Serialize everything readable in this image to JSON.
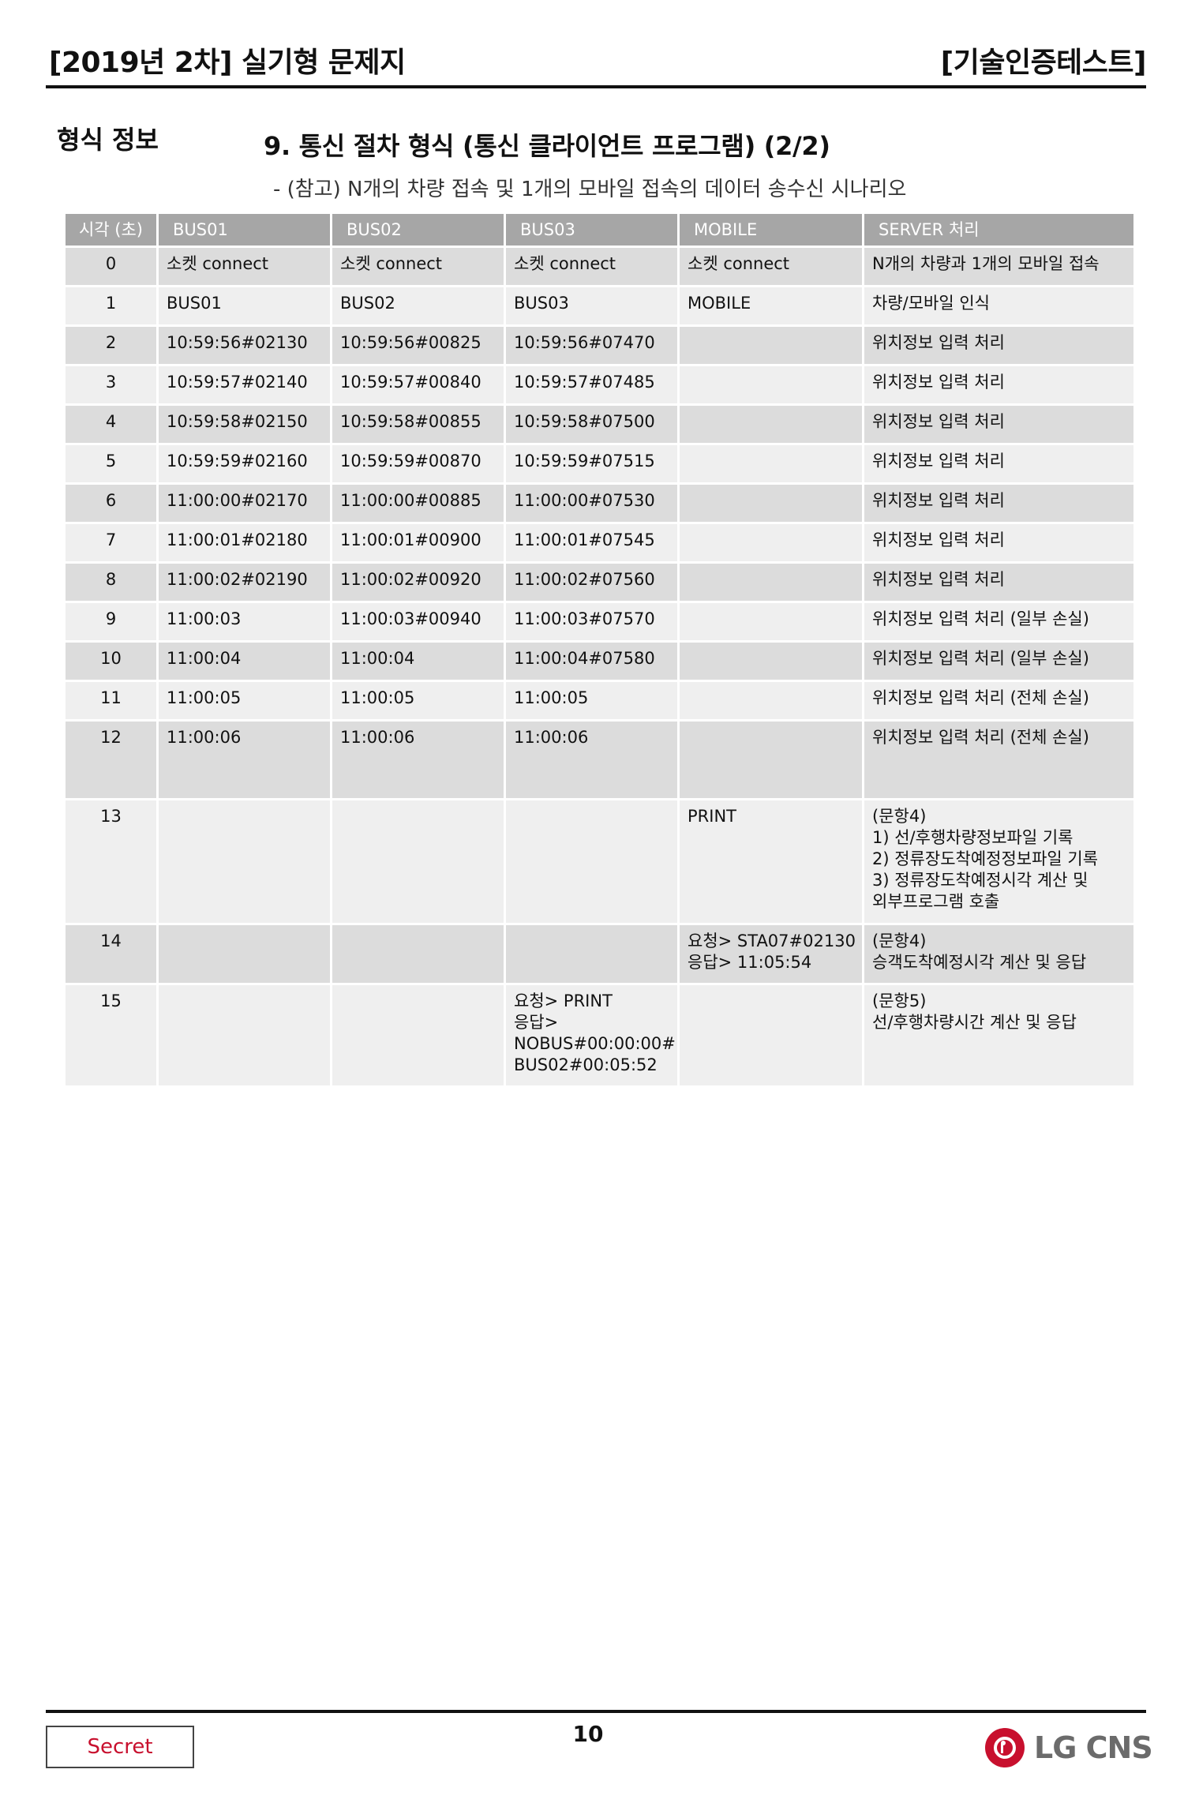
{
  "header": {
    "left": "[2019년 2차] 실기형 문제지",
    "right": "[기술인증테스트]"
  },
  "section": {
    "label": "형식 정보",
    "title": "9. 통신 절차 형식 (통신 클라이언트 프로그램) (2/2)",
    "note": "- (참고) N개의 차량 접속 및 1개의 모바일 접속의 데이터 송수신 시나리오"
  },
  "table": {
    "headers": [
      "시각 (초)",
      "BUS01",
      "BUS02",
      "BUS03",
      "MOBILE",
      "SERVER 처리"
    ],
    "rows": [
      [
        "0",
        "소켓 connect",
        "소켓 connect",
        "소켓 connect",
        "소켓 connect",
        "N개의 차량과 1개의 모바일 접속"
      ],
      [
        "1",
        "BUS01",
        "BUS02",
        "BUS03",
        "MOBILE",
        "차량/모바일 인식"
      ],
      [
        "2",
        "10:59:56#02130",
        "10:59:56#00825",
        "10:59:56#07470",
        "",
        "위치정보 입력 처리"
      ],
      [
        "3",
        "10:59:57#02140",
        "10:59:57#00840",
        "10:59:57#07485",
        "",
        "위치정보 입력 처리"
      ],
      [
        "4",
        "10:59:58#02150",
        "10:59:58#00855",
        "10:59:58#07500",
        "",
        "위치정보 입력 처리"
      ],
      [
        "5",
        "10:59:59#02160",
        "10:59:59#00870",
        "10:59:59#07515",
        "",
        "위치정보 입력 처리"
      ],
      [
        "6",
        "11:00:00#02170",
        "11:00:00#00885",
        "11:00:00#07530",
        "",
        "위치정보 입력 처리"
      ],
      [
        "7",
        "11:00:01#02180",
        "11:00:01#00900",
        "11:00:01#07545",
        "",
        "위치정보 입력 처리"
      ],
      [
        "8",
        "11:00:02#02190",
        "11:00:02#00920",
        "11:00:02#07560",
        "",
        "위치정보 입력 처리"
      ],
      [
        "9",
        "11:00:03",
        "11:00:03#00940",
        "11:00:03#07570",
        "",
        "위치정보 입력 처리 (일부 손실)"
      ],
      [
        "10",
        "11:00:04",
        "11:00:04",
        "11:00:04#07580",
        "",
        "위치정보 입력 처리 (일부 손실)"
      ],
      [
        "11",
        "11:00:05",
        "11:00:05",
        "11:00:05",
        "",
        "위치정보 입력 처리 (전체 손실)"
      ],
      [
        "12",
        "11:00:06",
        "11:00:06",
        "11:00:06",
        "",
        "위치정보 입력 처리 (전체 손실)"
      ],
      [
        "13",
        "",
        "",
        "",
        "PRINT",
        "(문항4)\n1) 선/후행차량정보파일 기록\n2) 정류장도착예정정보파일 기록\n3) 정류장도착예정시각 계산 및\n    외부프로그램 호출"
      ],
      [
        "14",
        "",
        "",
        "",
        "요청> STA07#02130\n응답> 11:05:54",
        "(문항4)\n승객도착예정시각 계산 및 응답"
      ],
      [
        "15",
        "",
        "",
        "요청> PRINT\n응답>\nNOBUS#00:00:00#\nBUS02#00:05:52",
        "",
        "(문항5)\n선/후행차량시간 계산 및 응답"
      ]
    ]
  },
  "footer": {
    "secret": "Secret",
    "page": "10",
    "logo": "LG CNS"
  },
  "colors": {
    "header_bg": "#a6a6a6",
    "row_dark": "#dcdcdc",
    "row_light": "#efefef",
    "brand_red": "#c8102e"
  }
}
